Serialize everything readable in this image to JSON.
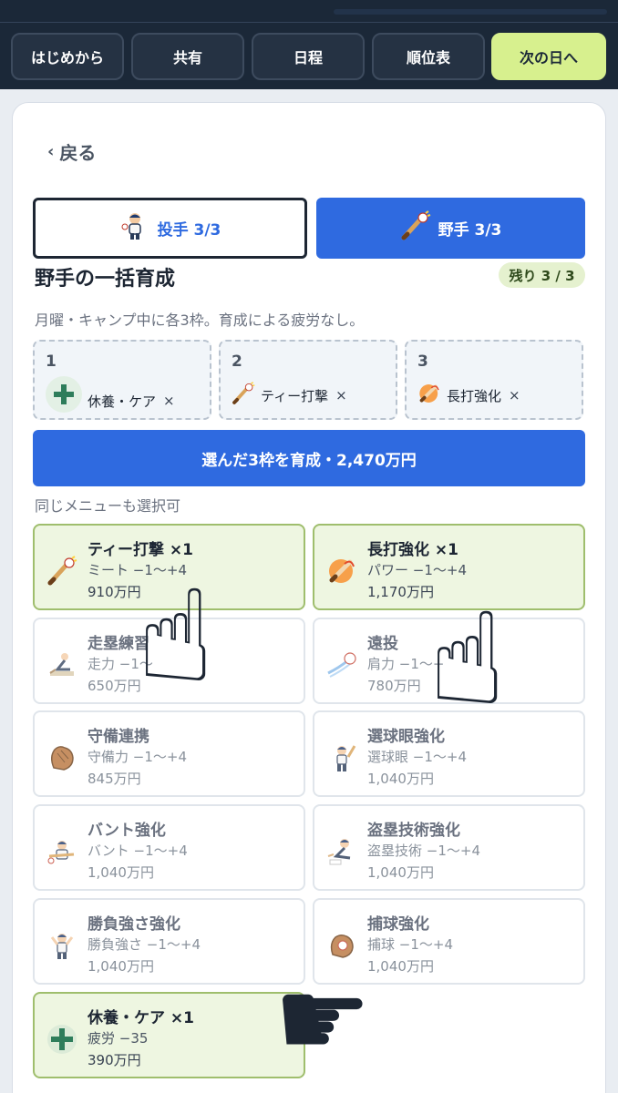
{
  "nav": {
    "items": [
      {
        "label": "はじめから"
      },
      {
        "label": "共有"
      },
      {
        "label": "日程"
      },
      {
        "label": "順位表"
      },
      {
        "label": "次の日へ"
      }
    ]
  },
  "back": {
    "label": "戻る"
  },
  "segments": {
    "pitcher": "投手 3/3",
    "fielder": "野手 3/3"
  },
  "section": {
    "title": "野手の一括育成",
    "remaining": "残り 3 / 3",
    "note": "月曜・キャンプ中に各3枠。育成による疲労なし。"
  },
  "slots": [
    {
      "num": "1",
      "label": "休養・ケア",
      "remove": "×",
      "icon": "plus-icon"
    },
    {
      "num": "2",
      "label": "ティー打撃",
      "remove": "×",
      "icon": "bat-ball-icon"
    },
    {
      "num": "3",
      "label": "長打強化",
      "remove": "×",
      "icon": "fire-bat-icon"
    }
  ],
  "train_button": "選んだ3枠を育成・2,470万円",
  "same_menu_note": "同じメニューも選択可",
  "menu": [
    {
      "name": "ティー打撃 ×1",
      "effect": "ミート −1〜+4",
      "price": "910万円",
      "icon": "bat-ball-icon",
      "selected": true
    },
    {
      "name": "長打強化 ×1",
      "effect": "パワー −1〜+4",
      "price": "1,170万円",
      "icon": "fire-bat-icon",
      "selected": true
    },
    {
      "name": "走塁練習",
      "effect": "走力 −1〜",
      "price": "650万円",
      "icon": "slide-runner-icon",
      "selected": false
    },
    {
      "name": "遠投",
      "effect": "肩力 −1〜+",
      "price": "780万円",
      "icon": "throw-ball-icon",
      "selected": false
    },
    {
      "name": "守備連携",
      "effect": "守備力 −1〜+4",
      "price": "845万円",
      "icon": "glove-icon",
      "selected": false
    },
    {
      "name": "選球眼強化",
      "effect": "選球眼 −1〜+4",
      "price": "1,040万円",
      "icon": "batter-icon",
      "selected": false
    },
    {
      "name": "バント強化",
      "effect": "バント −1〜+4",
      "price": "1,040万円",
      "icon": "bunt-player-icon",
      "selected": false
    },
    {
      "name": "盗塁技術強化",
      "effect": "盗塁技術 −1〜+4",
      "price": "1,040万円",
      "icon": "base-steal-icon",
      "selected": false
    },
    {
      "name": "勝負強さ強化",
      "effect": "勝負強さ −1〜+4",
      "price": "1,040万円",
      "icon": "clutch-player-icon",
      "selected": false
    },
    {
      "name": "捕球強化",
      "effect": "捕球 −1〜+4",
      "price": "1,040万円",
      "icon": "catch-glove-icon",
      "selected": false
    },
    {
      "name": "休養・ケア ×1",
      "effect": "疲労 −35",
      "price": "390万円",
      "icon": "plus-icon",
      "selected": true
    }
  ],
  "overlay": {
    "hand_glyph": "☝",
    "point_glyph": "☛"
  }
}
